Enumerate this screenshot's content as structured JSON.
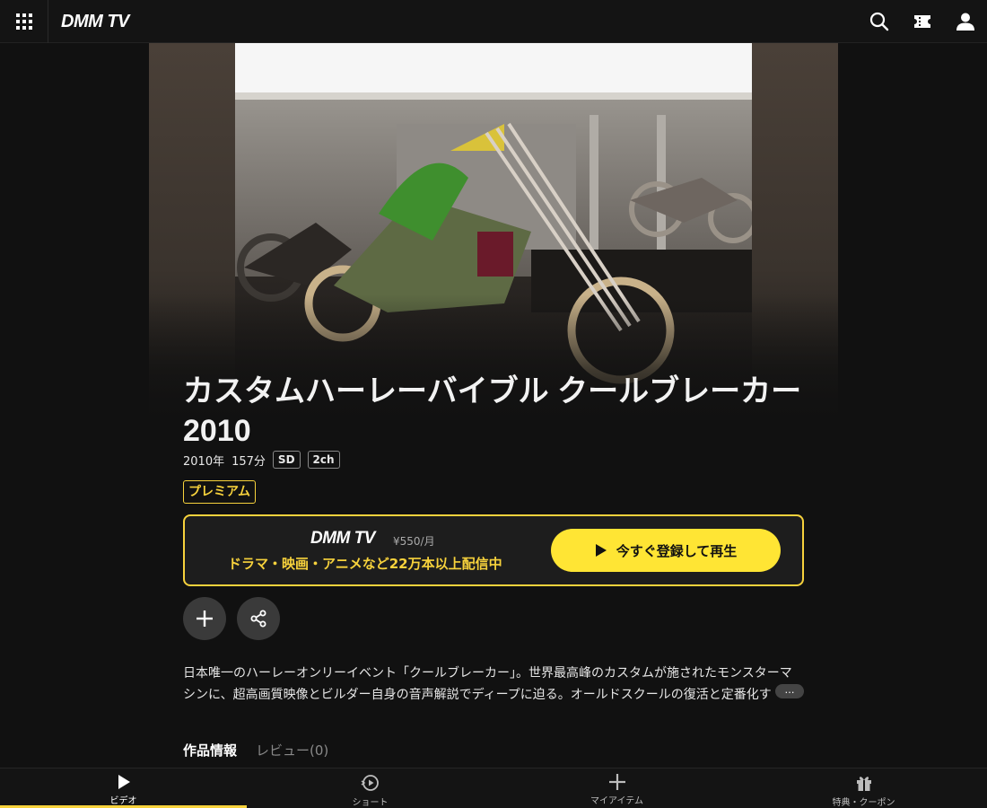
{
  "header": {
    "logo": "DMM TV",
    "icons": [
      "grid-menu-icon",
      "search-icon",
      "ticket-icon",
      "user-icon"
    ]
  },
  "title": "カスタムハーレーバイブル クールブレーカー2010",
  "meta": {
    "year": "2010年",
    "duration": "157分",
    "quality": "SD",
    "audio": "2ch"
  },
  "badge": "プレミアム",
  "promo": {
    "logo": "DMM TV",
    "price": "¥550/月",
    "tagline": "ドラマ・映画・アニメなど22万本以上配信中",
    "cta": "今すぐ登録して再生"
  },
  "actions": [
    "plus-icon",
    "share-icon"
  ],
  "description": "日本唯一のハーレーオンリーイベント「クールブレーカー」。世界最高峰のカスタムが施されたモンスターマシンに、超高画質映像とビルダー自身の音声解説でディープに迫る。オールドスクールの復活と定番化す",
  "more": "…",
  "tabs": [
    "作品情報",
    "レビュー(0)"
  ],
  "bottom_nav": [
    {
      "label": "ビデオ",
      "icon": "play-icon",
      "active": true
    },
    {
      "label": "ショート",
      "icon": "short-video-icon",
      "active": false
    },
    {
      "label": "マイアイテム",
      "icon": "plus-icon",
      "active": false
    },
    {
      "label": "特典・クーポン",
      "icon": "gift-icon",
      "active": false
    }
  ],
  "colors": {
    "accent": "#f7d23c",
    "cta": "#ffe534",
    "background": "#111111"
  }
}
